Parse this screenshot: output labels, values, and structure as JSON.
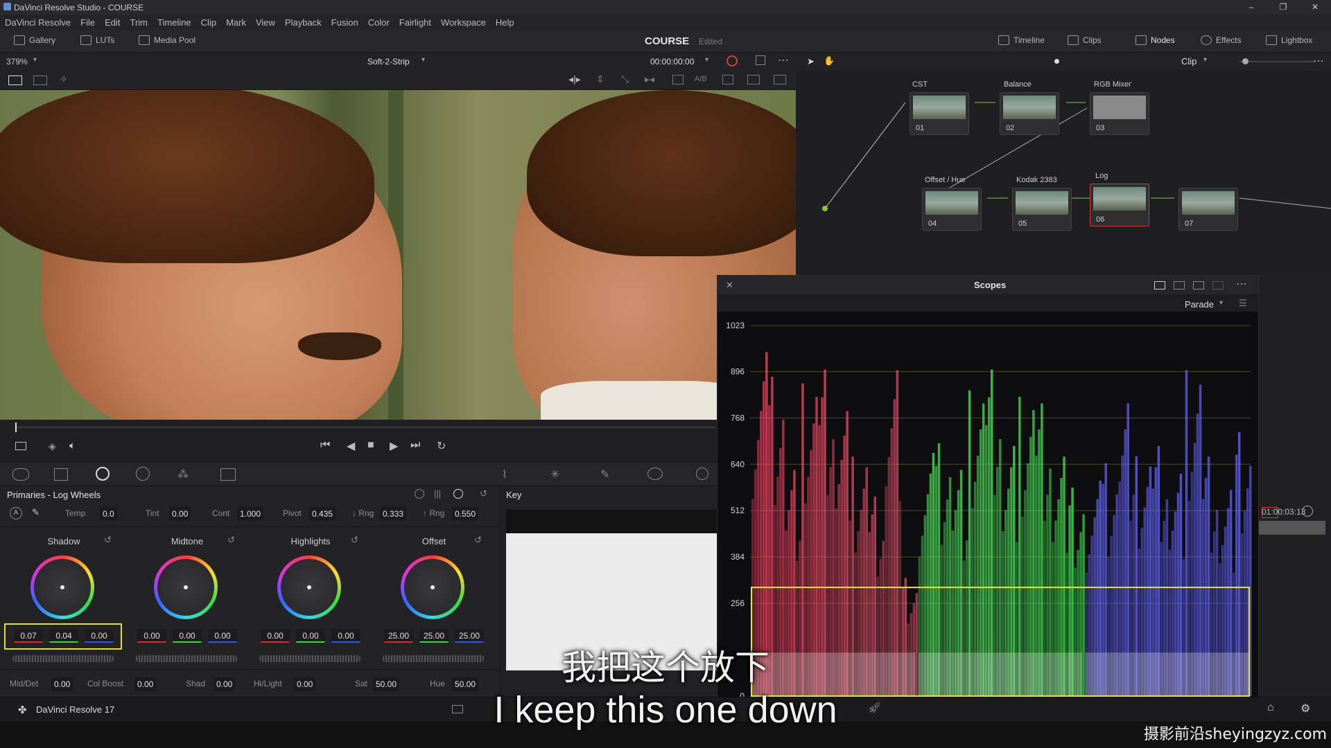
{
  "window": {
    "title": "DaVinci Resolve Studio - COURSE",
    "controls": [
      "–",
      "❐",
      "✕"
    ]
  },
  "menu": [
    "DaVinci Resolve",
    "File",
    "Edit",
    "Trim",
    "Timeline",
    "Clip",
    "Mark",
    "View",
    "Playback",
    "Fusion",
    "Color",
    "Fairlight",
    "Workspace",
    "Help"
  ],
  "toolbar": {
    "gallery": "Gallery",
    "luts": "LUTs",
    "media_pool": "Media Pool",
    "project": "COURSE",
    "status": "Edited",
    "timeline": "Timeline",
    "clips": "Clips",
    "nodes": "Nodes",
    "effects": "Effects",
    "lightbox": "Lightbox"
  },
  "viewer": {
    "zoom": "379%",
    "wipe_mode": "Soft-2-Strip",
    "timecode": "00:00:00:00",
    "ab_label": "A/B"
  },
  "nodes": {
    "mode": "Clip",
    "items": [
      {
        "label": "CST",
        "num": "01"
      },
      {
        "label": "Balance",
        "num": "02"
      },
      {
        "label": "RGB Mixer",
        "num": "03"
      },
      {
        "label": "Offset / Hue",
        "num": "04"
      },
      {
        "label": "Kodak 2383",
        "num": "05"
      },
      {
        "label": "Log",
        "num": "06"
      },
      {
        "label": "",
        "num": "07"
      }
    ]
  },
  "scopes": {
    "title": "Scopes",
    "mode": "Parade",
    "y_ticks": [
      "1023",
      "896",
      "768",
      "640",
      "512",
      "384",
      "256",
      "0"
    ]
  },
  "chart_data": {
    "type": "area",
    "title": "Parade",
    "ylim": [
      0,
      1023
    ],
    "y_ticks": [
      0,
      256,
      384,
      512,
      640,
      768,
      896,
      1023
    ],
    "series": [
      {
        "channel": "red",
        "color": "#ff4d6d",
        "peak_values": [
          990,
          960,
          680,
          900,
          940,
          820,
          720,
          600,
          980,
          340
        ]
      },
      {
        "channel": "green",
        "color": "#44ff55",
        "peak_values": [
          700,
          760,
          680,
          880,
          940,
          720,
          900,
          880,
          720,
          600
        ]
      },
      {
        "channel": "blue",
        "color": "#6c6cff",
        "peak_values": [
          620,
          700,
          880,
          690,
          720,
          640,
          980,
          720,
          620,
          760
        ]
      }
    ]
  },
  "primaries": {
    "title": "Primaries - Log Wheels",
    "temp_label": "Temp",
    "temp": "0.0",
    "tint_label": "Tint",
    "tint": "0.00",
    "cont_label": "Cont",
    "cont": "1.000",
    "pivot_label": "Pivot",
    "pivot": "0.435",
    "low_rng_label": "↓ Rng",
    "low_rng": "0.333",
    "high_rng_label": "↑ Rng",
    "high_rng": "0.550",
    "wheels": [
      {
        "name": "Shadow",
        "values": [
          "0.07",
          "0.04",
          "0.00"
        ]
      },
      {
        "name": "Midtone",
        "values": [
          "0.00",
          "0.00",
          "0.00"
        ]
      },
      {
        "name": "Highlights",
        "values": [
          "0.00",
          "0.00",
          "0.00"
        ]
      },
      {
        "name": "Offset",
        "values": [
          "25.00",
          "25.00",
          "25.00"
        ]
      }
    ],
    "middet_label": "Mid/Det",
    "middet": "0.00",
    "colboost_label": "Col Boost",
    "colboost": "0.00",
    "shad_label": "Shad",
    "shad": "0.00",
    "hilight_label": "Hi/Light",
    "hilight": "0.00",
    "sat_label": "Sat",
    "sat": "50.00",
    "hue_label": "Hue",
    "hue": "50.00"
  },
  "key": {
    "title": "Key"
  },
  "timeline_mini": {
    "timecode": "01:00:03:13"
  },
  "footer": {
    "app": "DaVinci Resolve 17"
  },
  "subtitles": {
    "cn": "我把这个放下",
    "en": "I keep this one down"
  },
  "watermark": "摄影前沿sheyingzyz.com"
}
